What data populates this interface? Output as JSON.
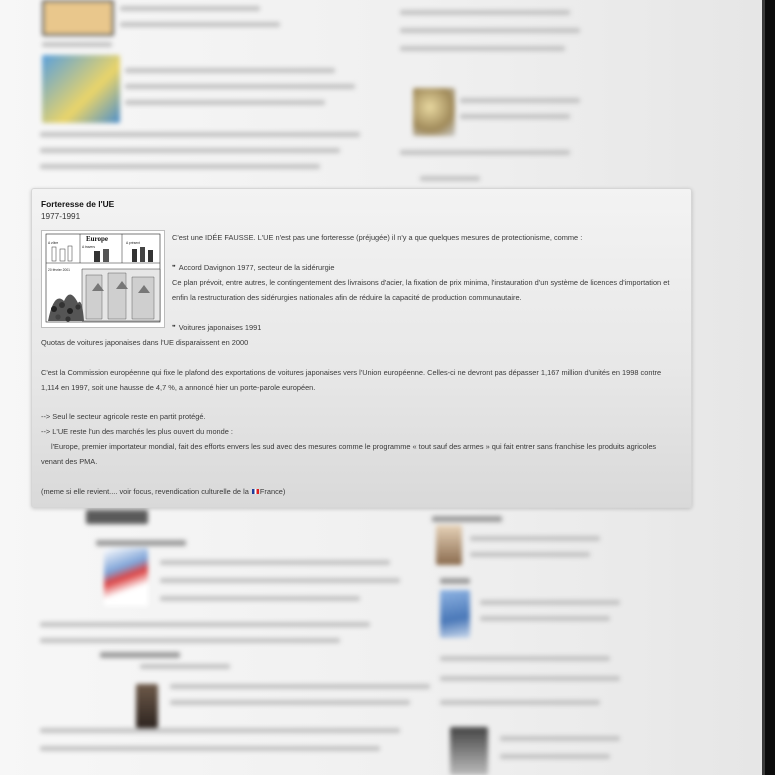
{
  "card": {
    "title": "Forteresse de l'UE",
    "dates": "1977-1991",
    "intro": "C'est une IDÉE FAUSSE. L'UE n'est pas une forteresse (préjugée) il n'y a que quelques mesures de protectionisme, comme :",
    "bullet_symbol": "❞",
    "item1_title": "Accord Davignon 1977, secteur de la sidérurgie",
    "item1_text_1": "Ce plan prévoit, entre autres, le contingentement des livraisons d'acier, la fixation de prix minima, l'instauration d'un système de licences d'importation et",
    "item1_text_2": "enfin la restructuration des sidérurgies nationales afin de réduire la capacité de production communautaire.",
    "item2_title": "Voitures japonaises 1991",
    "item2_text": "Quotas de voitures japonaises dans l'UE disparaissent en 2000",
    "para_1": "C'est la Commission européenne qui fixe le plafond des exportations de voitures japonaises vers l'Union européenne. Celles-ci ne devront pas dépasser 1,167 million d'unités en 1998 contre",
    "para_2": "1,114 en 1997, soit une hausse de 4,7 %, a annoncé hier un porte-parole européen.",
    "arrow_1": "--> Seul le secteur agricole reste en partit protégé.",
    "arrow_2": "--> L'UE reste l'un des marchés les plus ouvert du monde :",
    "quote_1": "l'Europe, premier importateur mondial, fait des efforts envers les sud   avec des mesures comme le programme « tout sauf des armes » qui   fait entrer sans franchise les produits agricoles",
    "quote_2": "venant des PMA.",
    "footer_before": "(meme si elle revient.... voir focus, revendication culturelle de la ",
    "footer_after": "France)",
    "illustration": {
      "heading": "Europe",
      "caption_1": "A vôtre",
      "caption_2": "A travers",
      "caption_3": "A présent",
      "date": "20 février 2001"
    }
  }
}
